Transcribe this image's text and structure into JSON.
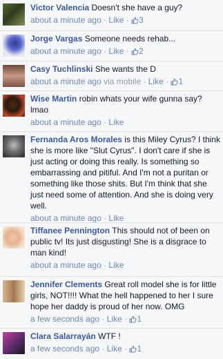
{
  "comments": [
    {
      "author": "Victor Valencia",
      "text": "Doesn't she have a guy?",
      "time": "about a minute ago",
      "via": "",
      "like": "Like",
      "likes": "3"
    },
    {
      "author": "Jorge Vargas",
      "text": "Someone needs rehab...",
      "time": "about a minute ago",
      "via": "",
      "like": "Like",
      "likes": "2"
    },
    {
      "author": "Casy Tuchlinski",
      "text": "She wants the D",
      "time": "about a minute ago",
      "via": "via mobile",
      "like": "Like",
      "likes": "1"
    },
    {
      "author": "Wise Martin",
      "text": "robin whats your wife gunna say? lmao",
      "time": "about a minute ago",
      "via": "",
      "like": "Like",
      "likes": ""
    },
    {
      "author": "Fernanda Aros Morales",
      "text": "is this Miley Cyrus? I think she is more like \"Slut Cyrus\". I don't care if she is just acting or doing this really. Is something so embarrassing and pitiful. And I'm not a puritan or something like those shits. But I'm think that she just need some of attention. And she is doing very well.",
      "time": "about a minute ago",
      "via": "",
      "like": "Like",
      "likes": ""
    },
    {
      "author": "Tiffanee Pennington",
      "text": "This should not of been on public tv! Its just disgusting! She is a disgrace to man kind!",
      "time": "about a minute ago",
      "via": "",
      "like": "Like",
      "likes": ""
    },
    {
      "author": "Jennifer Clements",
      "text": "Great roll model she is for little girls, NOT!!!! What the hell happened to her I sure hope her daddy is proud of her now. OMG",
      "time": "a few seconds ago",
      "via": "",
      "like": "Like",
      "likes": "1"
    },
    {
      "author": "Clara Salarrayán",
      "text": "WTF !",
      "time": "a few seconds ago",
      "via": "",
      "like": "Like",
      "likes": "1"
    }
  ],
  "colors": {
    "author": "#3b5998",
    "link": "#6d84b4",
    "meta": "#9197a3",
    "background": "#f6f7f8",
    "divider": "#e1e2e3"
  },
  "icons": {
    "like_count": "thumbs-up-icon"
  }
}
